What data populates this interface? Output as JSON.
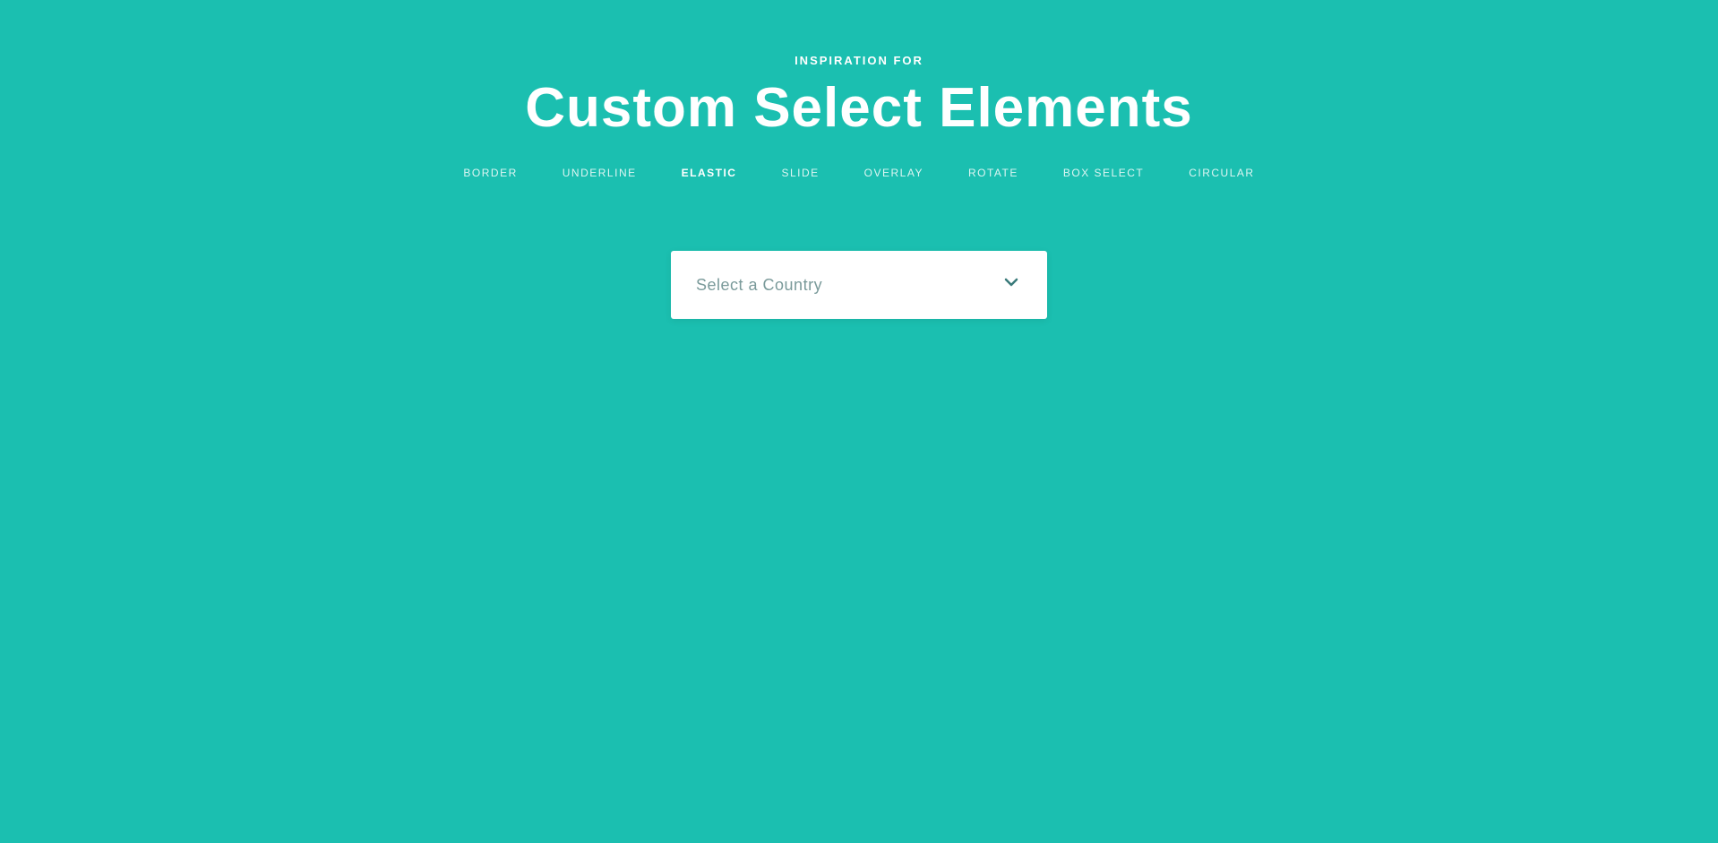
{
  "header": {
    "subtitle": "INSPIRATION FOR",
    "title": "Custom Select Elements"
  },
  "nav": {
    "items": [
      {
        "label": "BORDER",
        "active": false
      },
      {
        "label": "UNDERLINE",
        "active": false
      },
      {
        "label": "ELASTIC",
        "active": true
      },
      {
        "label": "SLIDE",
        "active": false
      },
      {
        "label": "OVERLAY",
        "active": false
      },
      {
        "label": "ROTATE",
        "active": false
      },
      {
        "label": "BOX SELECT",
        "active": false
      },
      {
        "label": "CIRCULAR",
        "active": false
      }
    ]
  },
  "select": {
    "placeholder": "Select a Country",
    "chevron_icon": "chevron-down"
  },
  "colors": {
    "background": "#1bbfb0",
    "select_bg": "#ffffff",
    "placeholder_color": "#7a9a9a",
    "chevron_color": "#3a7a7a"
  }
}
